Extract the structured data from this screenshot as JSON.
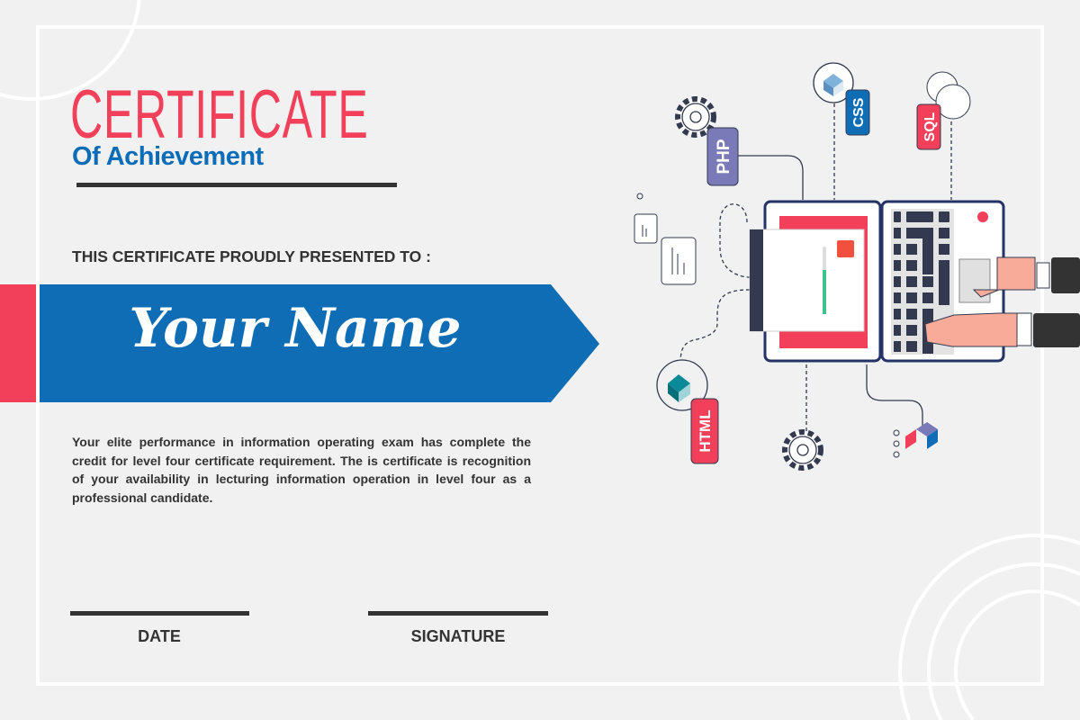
{
  "certificate": {
    "title": "CERTIFICATE",
    "subtitle": "Of Achievement",
    "presented_to": "THIS CERTIFICATE PROUDLY PRESENTED TO :",
    "recipient_name": "Your Name",
    "body": "Your elite performance in information operating exam has complete the credit for level four certificate requirement. The is certificate is recognition of  your availability in lecturing information operation in level four as a professional candidate.",
    "date_label": "DATE",
    "signature_label": "SIGNATURE"
  },
  "illustration": {
    "tags": [
      "PHP",
      "CSS",
      "SQL",
      "HTML"
    ]
  },
  "colors": {
    "red": "#f3405a",
    "blue": "#0f6db5",
    "dark": "#333333",
    "background": "#f1f1f1"
  }
}
